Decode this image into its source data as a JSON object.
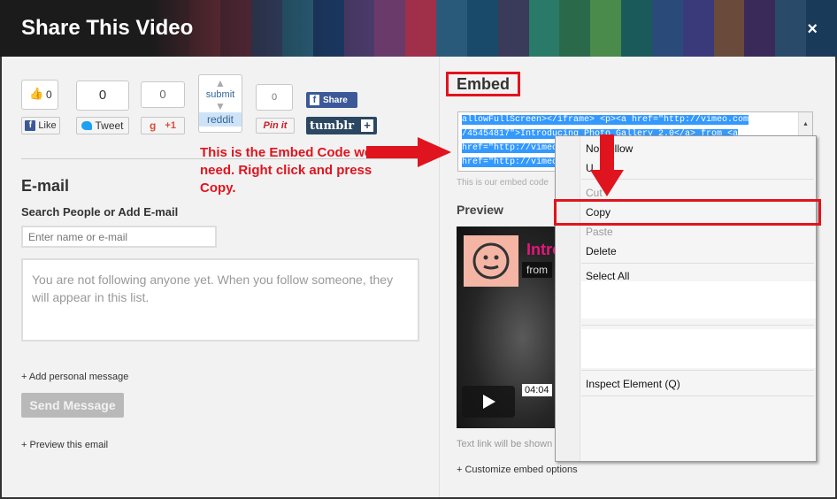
{
  "header": {
    "title": "Share This Video",
    "close_glyph": "×",
    "stripe_colors": [
      "#3a2a4a",
      "#6a2a5a",
      "#b03a5a",
      "#d0405a",
      "#8a3050",
      "#3a4a7a",
      "#2a6a8a",
      "#1a3a6a",
      "#4a3a6a",
      "#6a3a6a",
      "#a0304a",
      "#2a5a7a",
      "#1a4a6a",
      "#3a3a5a",
      "#2a7a6a",
      "#2a6a4a",
      "#4a8a4a",
      "#1a5a5a",
      "#2a4a7a",
      "#3a3a7a",
      "#6a4a3a",
      "#3a2a5a",
      "#2a4a6a",
      "#1a3a5a"
    ]
  },
  "social": {
    "like_count": "0",
    "like_label": "Like",
    "tweet_count": "0",
    "tweet_label": "Tweet",
    "gplus_count": "0",
    "gplus_label": "+1",
    "gplus_glyph": "g",
    "reddit_label": "reddit",
    "reddit_submit": "submit",
    "pinterest_count": "0",
    "pinterest_label": "Pin it",
    "fb_share_label": "Share",
    "tumblr_label": "tumblr",
    "tumblr_plus": "+"
  },
  "annotation": {
    "text": "This is the Embed Code we need. Right click and press Copy."
  },
  "email": {
    "heading": "E-mail",
    "search_label": "Search People or Add E-mail",
    "search_placeholder": "Enter name or e-mail",
    "follow_message": "You are not following anyone yet. When you follow someone, they will appear in this list.",
    "add_message_link": "+ Add personal message",
    "send_button": "Send Message",
    "preview_link": "+ Preview this email"
  },
  "embed": {
    "heading": "Embed",
    "code_lines": [
      "allowFullScreen></iframe> <p><a href=\"http://vimeo.com",
      "/45454817\">Introducing Photo Gallery 2.0</a> from <a",
      "href=\"http://vimeo",
      "href=\"http://vimeo"
    ],
    "hint": "This is our embed code"
  },
  "preview": {
    "heading": "Preview",
    "video_title": "Intro",
    "video_from": "from",
    "time": "04:04",
    "text_link_note": "Text link will be shown",
    "customize_link": "+ Customize embed options"
  },
  "context_menu": {
    "items": [
      {
        "label": "No Follow",
        "disabled": false
      },
      {
        "label": "U",
        "disabled": false
      },
      {
        "label": "Cut",
        "disabled": true
      },
      {
        "label": "Copy",
        "disabled": false
      },
      {
        "label": "Paste",
        "disabled": true
      },
      {
        "label": "Delete",
        "disabled": false
      },
      {
        "label": "Select All",
        "disabled": false
      },
      {
        "label": "Inspect Element (Q)",
        "disabled": false
      }
    ]
  },
  "colors": {
    "annotation_red": "#e0141e",
    "selection_blue": "#3399ff",
    "facebook": "#3b5998",
    "tumblr": "#2c4762"
  }
}
